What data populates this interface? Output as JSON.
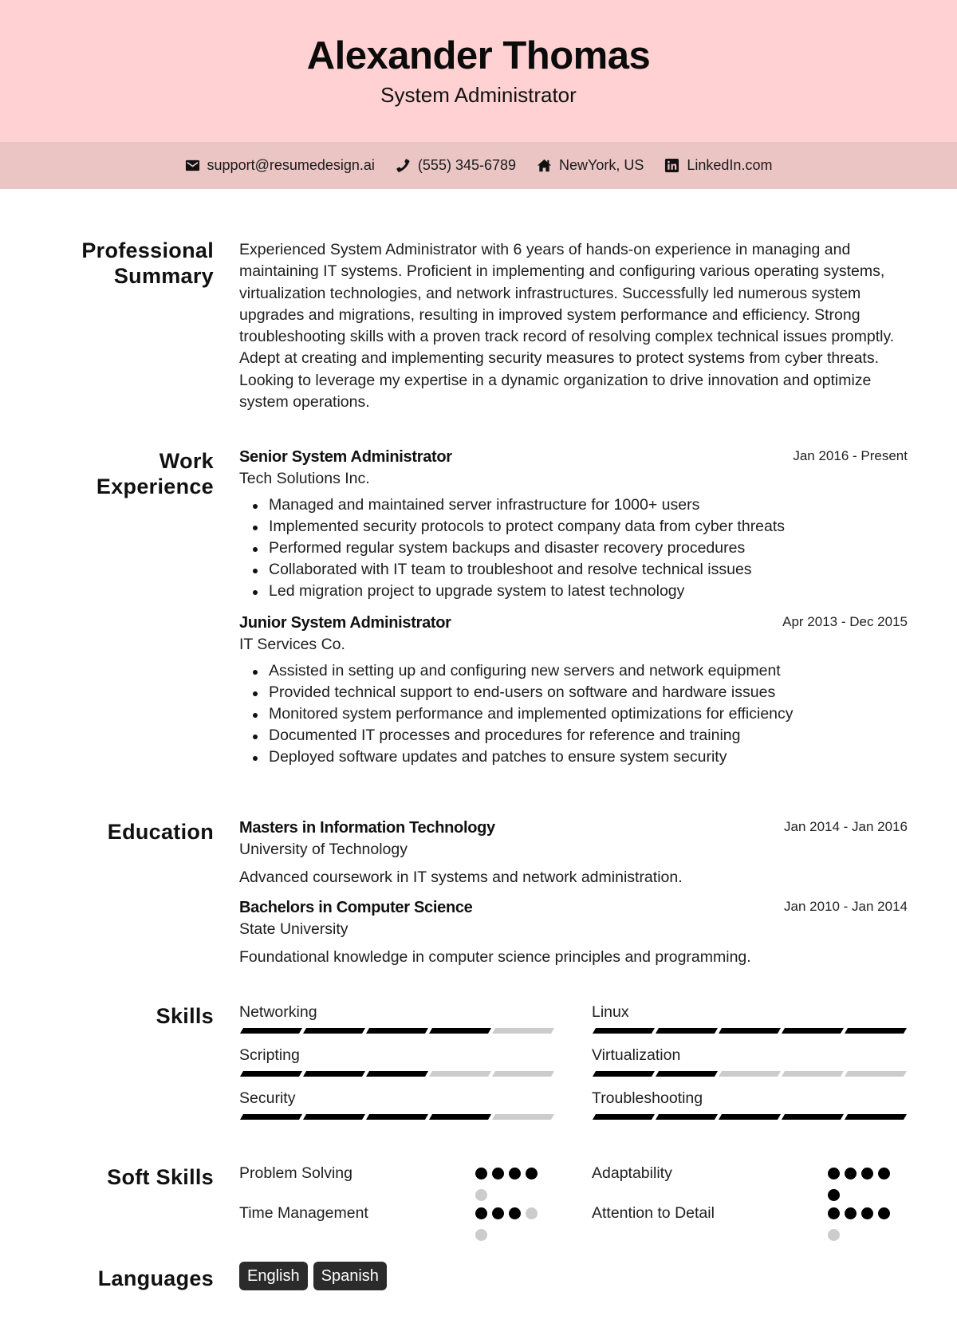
{
  "header": {
    "name": "Alexander Thomas",
    "title": "System Administrator",
    "background_color": "#ffd1d2"
  },
  "contact": {
    "background_color": "#ebc4c4",
    "items": [
      {
        "icon": "envelope-icon",
        "text": "support@resumedesign.ai"
      },
      {
        "icon": "phone-icon",
        "text": "(555) 345-6789"
      },
      {
        "icon": "home-icon",
        "text": "NewYork, US"
      },
      {
        "icon": "linkedin-icon",
        "text": "LinkedIn.com"
      }
    ]
  },
  "sections": {
    "summary": {
      "label_line1": "Professional",
      "label_line2": "Summary",
      "text": "Experienced System Administrator with 6 years of hands-on experience in managing and maintaining IT systems. Proficient in implementing and configuring various operating systems, virtualization technologies, and network infrastructures. Successfully led numerous system upgrades and migrations, resulting in improved system performance and efficiency. Strong troubleshooting skills with a proven track record of resolving complex technical issues promptly. Adept at creating and implementing security measures to protect systems from cyber threats. Looking to leverage my expertise in a dynamic organization to drive innovation and optimize system operations."
    },
    "experience": {
      "label_line1": "Work",
      "label_line2": "Experience",
      "jobs": [
        {
          "title": "Senior System Administrator",
          "company": "Tech Solutions Inc.",
          "dates": "Jan 2016 - Present",
          "bullets": [
            "Managed and maintained server infrastructure for 1000+ users",
            "Implemented security protocols to protect company data from cyber threats",
            "Performed regular system backups and disaster recovery procedures",
            "Collaborated with IT team to troubleshoot and resolve technical issues",
            "Led migration project to upgrade system to latest technology"
          ]
        },
        {
          "title": "Junior System Administrator",
          "company": "IT Services Co.",
          "dates": "Apr 2013 - Dec 2015",
          "bullets": [
            "Assisted in setting up and configuring new servers and network equipment",
            "Provided technical support to end-users on software and hardware issues",
            "Monitored system performance and implemented optimizations for efficiency",
            "Documented IT processes and procedures for reference and training",
            "Deployed software updates and patches to ensure system security"
          ]
        }
      ]
    },
    "education": {
      "label": "Education",
      "items": [
        {
          "degree": "Masters in Information Technology",
          "school": "University of Technology",
          "dates": "Jan 2014 - Jan 2016",
          "description": "Advanced coursework in IT systems and network administration."
        },
        {
          "degree": "Bachelors in Computer Science",
          "school": "State University",
          "dates": "Jan 2010 - Jan 2014",
          "description": "Foundational knowledge in computer science principles and programming."
        }
      ]
    },
    "skills": {
      "label": "Skills",
      "max_level": 5,
      "items": [
        {
          "name": "Networking",
          "level": 4
        },
        {
          "name": "Linux",
          "level": 5
        },
        {
          "name": "Scripting",
          "level": 3
        },
        {
          "name": "Virtualization",
          "level": 2
        },
        {
          "name": "Security",
          "level": 4
        },
        {
          "name": "Troubleshooting",
          "level": 5
        }
      ]
    },
    "soft_skills": {
      "label": "Soft Skills",
      "max_level": 5,
      "items": [
        {
          "name": "Problem Solving",
          "level": 4
        },
        {
          "name": "Adaptability",
          "level": 5
        },
        {
          "name": "Time Management",
          "level": 3
        },
        {
          "name": "Attention to Detail",
          "level": 4
        }
      ]
    },
    "languages": {
      "label": "Languages",
      "items": [
        "English",
        "Spanish"
      ]
    }
  }
}
